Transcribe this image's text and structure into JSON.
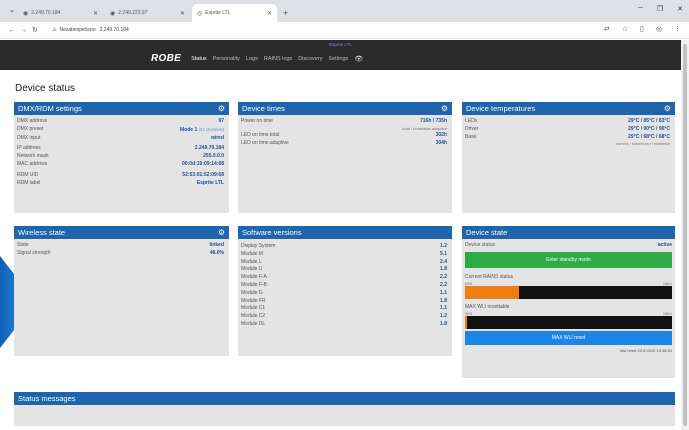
{
  "browser": {
    "tabs": [
      {
        "title": "2.249.70.184",
        "active": false
      },
      {
        "title": "2.249.223.97",
        "active": false
      },
      {
        "title": "Esprite LTL",
        "active": true
      }
    ],
    "address": {
      "security": "Nezabezpečeno",
      "url": "2.249.70.184"
    }
  },
  "app": {
    "device_name": "Esprite LTL",
    "logo": "ROBE",
    "menu": [
      "Status",
      "Personality",
      "Logs",
      "RAINS logs",
      "Discovery",
      "Settings"
    ],
    "active_menu": "Status"
  },
  "page": {
    "title": "Device status"
  },
  "dmx": {
    "title": "DMX/RDM settings",
    "rows": [
      {
        "label": "DMX address",
        "value": "97",
        "note": ""
      },
      {
        "label": "DMX preset",
        "value": "Mode 1",
        "note": "(52 channels)"
      },
      {
        "label": "DMX input",
        "value": "wired",
        "note": ""
      },
      {
        "label": "IP address",
        "value": "2.249.70.184",
        "note": ""
      },
      {
        "label": "Network mask",
        "value": "255.0.0.0",
        "note": ""
      },
      {
        "label": "MAC address",
        "value": "00:0d:19:09:14:68",
        "note": ""
      },
      {
        "label": "RDM UID",
        "value": "52:53:01:52:09:68",
        "note": ""
      },
      {
        "label": "RDM label",
        "value": "Esprite LTL",
        "note": ""
      }
    ]
  },
  "times": {
    "title": "Device times",
    "rows": [
      {
        "label": "Power on time",
        "value": "716h / 735h"
      },
      {
        "label": "LED on time total",
        "value": "302h"
      },
      {
        "label": "LED on time adaptive",
        "value": "304h"
      }
    ],
    "sub": "total / resettable adaptive"
  },
  "temps": {
    "title": "Device temperatures",
    "rows": [
      {
        "label": "LEDs",
        "value": "29°C / 85°C / 83°C"
      },
      {
        "label": "Driver",
        "value": "29°C / 90°C / 90°C"
      },
      {
        "label": "Base",
        "value": "29°C / 68°C / 68°C"
      }
    ],
    "sub": "current / maximum / resettable"
  },
  "wireless": {
    "title": "Wireless state",
    "rows": [
      {
        "label": "State",
        "value": "linked"
      },
      {
        "label": "Signal strength",
        "value": "48.0%"
      }
    ]
  },
  "software": {
    "title": "Software versions",
    "rows": [
      {
        "label": "Display System",
        "value": "1.2"
      },
      {
        "label": "Module M",
        "value": "5.1"
      },
      {
        "label": "Module L",
        "value": "2.4"
      },
      {
        "label": "Module U",
        "value": "1.8"
      },
      {
        "label": "Module F-A",
        "value": "2.2"
      },
      {
        "label": "Module F-B",
        "value": "2.2"
      },
      {
        "label": "Module G",
        "value": "1.1"
      },
      {
        "label": "Module FR",
        "value": "1.8"
      },
      {
        "label": "Module C1",
        "value": "1.1"
      },
      {
        "label": "Module C2",
        "value": "1.2"
      },
      {
        "label": "Module DL",
        "value": "1.8"
      }
    ]
  },
  "state": {
    "title": "Device state",
    "status_label": "Device status",
    "status_value": "active",
    "standby_button": "Enter standby mode",
    "rains_label": "Current RAINS status",
    "rains_min": "MIN",
    "rains_max": "MAX",
    "rains_level": 0.26,
    "wli_label": "MAX WLI resettable",
    "wli_min": "MIN",
    "wli_max": "MAX",
    "wli_level": 0.01,
    "reset_button": "MAX WLI reset",
    "last_reset": "last reset 20.8.2020 19:48:34"
  },
  "status_messages": {
    "title": "Status messages"
  },
  "colors": {
    "panel_header": "#1e65ad",
    "panel_bg": "#e4e4e4",
    "green_button": "#2eaa47",
    "blue_button": "#1a87e8",
    "bar_fill": "#f07d10"
  }
}
